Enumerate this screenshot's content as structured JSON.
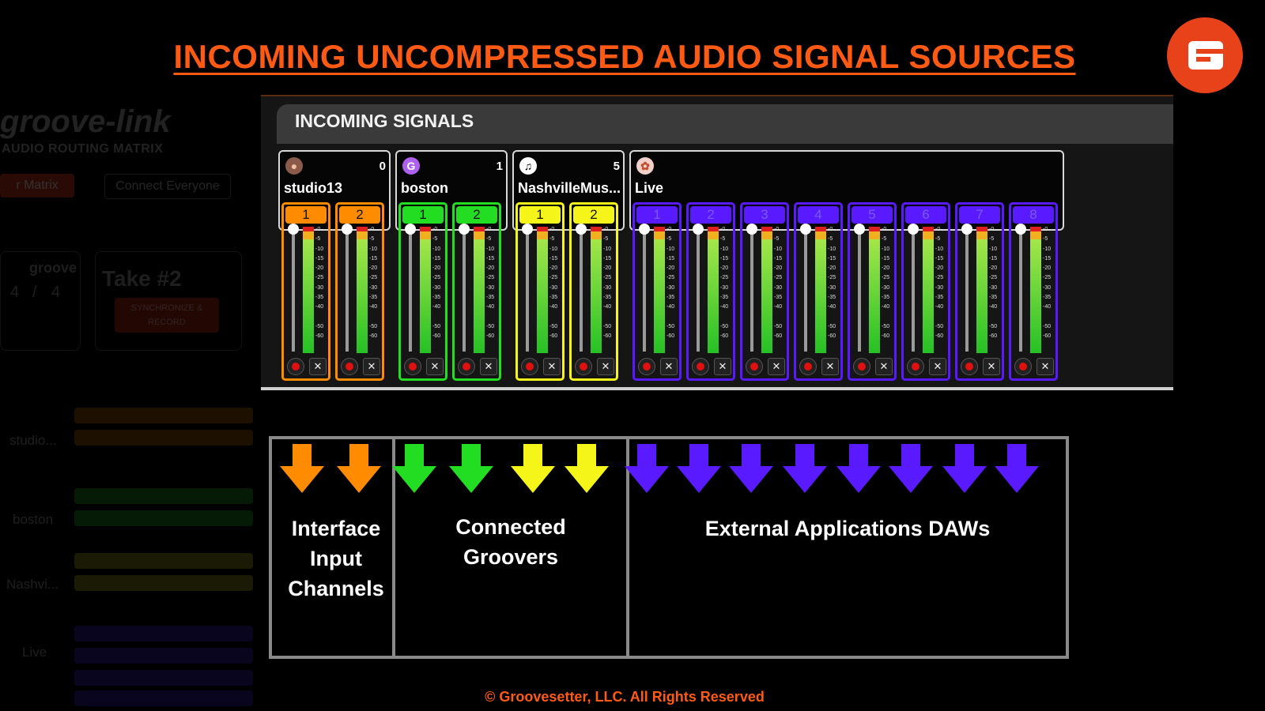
{
  "title": "INCOMING UNCOMPRESSED AUDIO SIGNAL SOURCES",
  "background_app": {
    "brand": "groove-link",
    "subtitle": "AUDIO ROUTING MATRIX",
    "buttons": [
      "r Matrix",
      "Connect Everyone"
    ],
    "groove_label": "groove",
    "signature": [
      "4",
      "/",
      "4"
    ],
    "take_title": "Take #2",
    "sync_button": "SYNCHRONIZE & RECORD",
    "users": [
      "studio...",
      "boston",
      "Nashvi...",
      "Live"
    ]
  },
  "panel": {
    "title": "INCOMING SIGNALS",
    "groups": [
      {
        "name": "studio13",
        "count": "0",
        "icon": "user-photo-icon",
        "color": "#ff8c00",
        "channels": [
          "1",
          "2"
        ]
      },
      {
        "name": "boston",
        "count": "1",
        "icon": "groovesetter-g-icon",
        "color": "#22dd22",
        "channels": [
          "1",
          "2"
        ]
      },
      {
        "name": "NashvilleMus...",
        "count": "5",
        "icon": "music-note-icon",
        "color": "#f5f51a",
        "channels": [
          "1",
          "2"
        ]
      },
      {
        "name": "Live",
        "count": "",
        "icon": "live-icon",
        "color": "#5a1aff",
        "channels": [
          "1",
          "2",
          "3",
          "4",
          "5",
          "6",
          "7",
          "8"
        ]
      }
    ],
    "meter_scale": [
      "-0",
      "-5",
      "-10",
      "-15",
      "-20",
      "-25",
      "-30",
      "-35",
      "-40",
      "-50",
      "-60"
    ]
  },
  "arrows": {
    "colors": [
      "#ff8c00",
      "#ff8c00",
      "#22dd22",
      "#22dd22",
      "#f5f51a",
      "#f5f51a",
      "#5a1aff",
      "#5a1aff",
      "#5a1aff",
      "#5a1aff",
      "#5a1aff",
      "#5a1aff",
      "#5a1aff",
      "#5a1aff"
    ]
  },
  "labels": {
    "interface": [
      "Interface",
      "Input",
      "Channels"
    ],
    "groovers": [
      "Connected",
      "Groovers"
    ],
    "external": "External Applications DAWs"
  },
  "copyright": "© Groovesetter, LLC.  All Rights Reserved"
}
